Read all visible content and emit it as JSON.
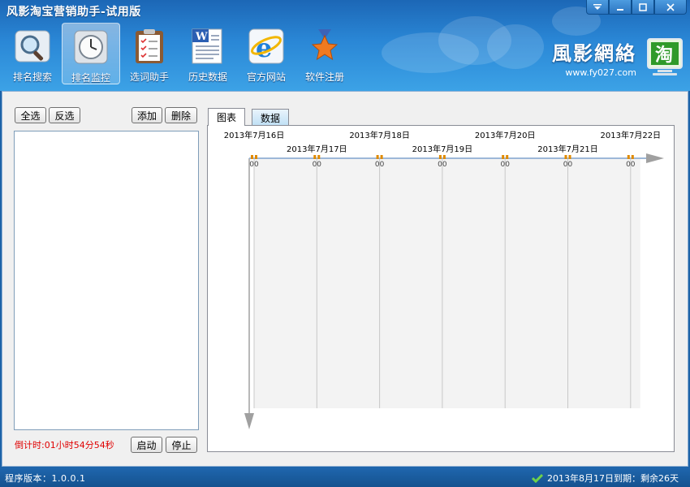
{
  "window": {
    "title": "风影淘宝营销助手-试用版",
    "controls": [
      "menu",
      "minimize",
      "maximize",
      "close"
    ]
  },
  "toolbar": {
    "items": [
      {
        "label": "排名搜索",
        "icon": "magnifier-icon",
        "active": false
      },
      {
        "label": "排名监控",
        "icon": "clock-icon",
        "active": true
      },
      {
        "label": "选词助手",
        "icon": "clipboard-icon",
        "active": false
      },
      {
        "label": "历史数据",
        "icon": "word-document-icon",
        "active": false
      },
      {
        "label": "官方网站",
        "icon": "ie-browser-icon",
        "active": false
      },
      {
        "label": "软件注册",
        "icon": "star-medal-icon",
        "active": false
      }
    ]
  },
  "brand": {
    "name": "風影網絡",
    "url": "www.fy027.com",
    "logo_char": "淘"
  },
  "left_panel": {
    "select_all": "全选",
    "invert_select": "反选",
    "add": "添加",
    "delete": "删除",
    "countdown": "倒计时:01小时54分54秒",
    "start": "启动",
    "stop": "停止"
  },
  "tabs": [
    {
      "label": "图表",
      "selected": true
    },
    {
      "label": "数据",
      "selected": false
    }
  ],
  "chart_data": {
    "type": "line",
    "x": [
      "2013年7月16日",
      "2013年7月17日",
      "2013年7月18日",
      "2013年7月19日",
      "2013年7月20日",
      "2013年7月21日",
      "2013年7月22日"
    ],
    "point_labels": [
      "00",
      "00",
      "00",
      "00",
      "00",
      "00",
      "00"
    ],
    "colors": {
      "axis": "#a0a0a0",
      "grid": "#c8c8c8",
      "band": "#f3f3f3",
      "line": "#9db8d8",
      "marker": "#e08a00"
    }
  },
  "status": {
    "version": "程序版本：1.0.0.1",
    "expiry": "2013年8月17日到期：剩余26天"
  },
  "colors": {
    "header_top": "#1c67b6",
    "header_bottom": "#3ca2e6",
    "countdown": "#e00000"
  }
}
